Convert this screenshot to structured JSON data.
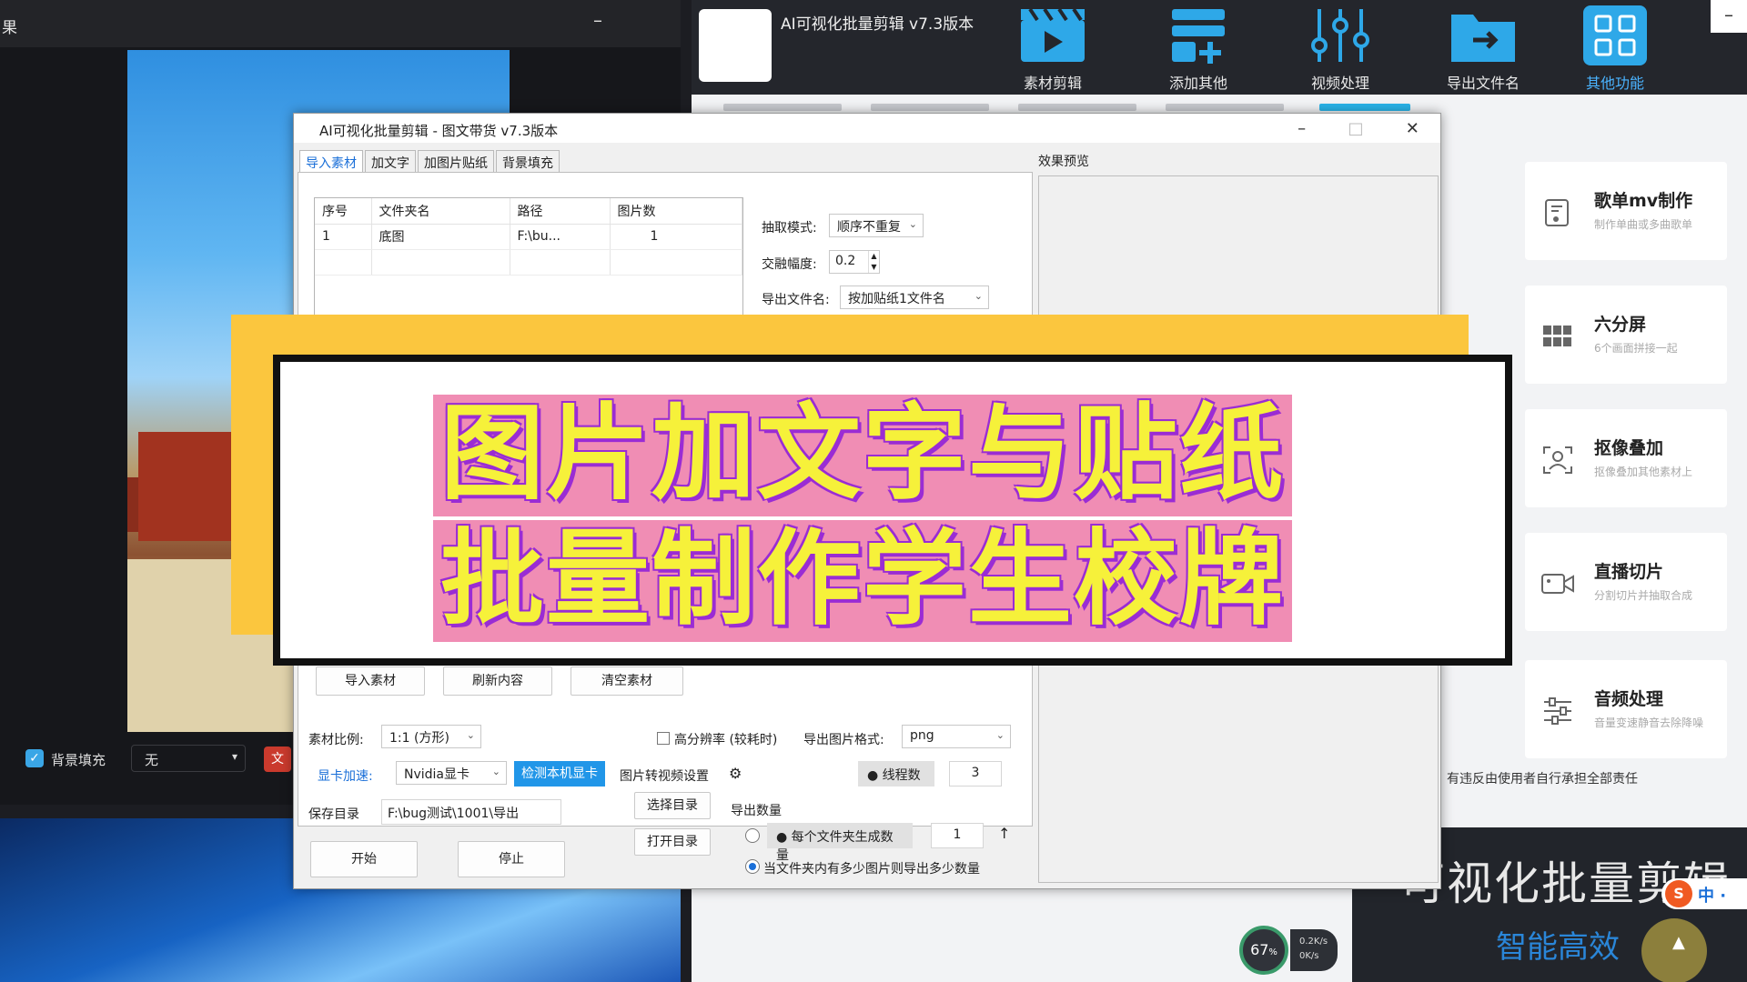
{
  "left_window": {
    "title": "果",
    "minimize": "–",
    "bg_fill_checkbox_label": "背景填充",
    "bg_fill_select": "无",
    "chip": "文"
  },
  "app": {
    "title": "AI可视化批量剪辑 v7.3版本",
    "close_btn": "–",
    "nav": [
      {
        "label": "素材剪辑",
        "icon": "clapperboard-icon"
      },
      {
        "label": "添加其他",
        "icon": "add-layers-icon"
      },
      {
        "label": "视频处理",
        "icon": "sliders-icon"
      },
      {
        "label": "导出文件名",
        "icon": "folder-export-icon"
      },
      {
        "label": "其他功能",
        "icon": "grid-apps-icon",
        "active": true
      }
    ],
    "cards": [
      {
        "title": "歌单mv制作",
        "sub": "制作单曲或多曲歌单",
        "icon": "music-list-icon"
      },
      {
        "title": "六分屏",
        "sub": "6个画面拼接一起",
        "icon": "six-grid-icon"
      },
      {
        "title": "抠像叠加",
        "sub": "抠像叠加其他素材上",
        "icon": "portrait-icon"
      },
      {
        "title": "直播切片",
        "sub": "分割切片并抽取合成",
        "icon": "video-camera-icon"
      },
      {
        "title": "音频处理",
        "sub": "音量变速静音去除降噪",
        "icon": "audio-sliders-icon"
      }
    ],
    "disclaimer": "有违反由使用者自行承担全部责任",
    "promo_title": "可视化批量剪辑",
    "promo_sub": "智能高效",
    "ime": {
      "s": "S",
      "mode": "中 ·"
    },
    "netmon": {
      "percent": "67",
      "unit": "%",
      "up": "0.2K/s",
      "down": "0K/s"
    }
  },
  "dialog": {
    "title": "AI可视化批量剪辑 - 图文带货 v7.3版本",
    "controls": {
      "min": "–",
      "max": "□",
      "close": "✕"
    },
    "tabs": [
      "导入素材",
      "加文字",
      "加图片贴纸",
      "背景填充"
    ],
    "table": {
      "headers": [
        "序号",
        "文件夹名",
        "路径",
        "图片数"
      ],
      "rows": [
        [
          "1",
          "底图",
          "F:\\bu...",
          "1"
        ]
      ]
    },
    "extract_mode_label": "抽取模式:",
    "extract_mode_value": "顺序不重复",
    "blend_label": "交融幅度:",
    "blend_value": "0.2",
    "export_name_label": "导出文件名:",
    "export_name_value": "按加贴纸1文件名",
    "preview_label": "效果预览",
    "buttons": {
      "import": "导入素材",
      "refresh": "刷新内容",
      "clear": "清空素材",
      "choose_dir": "选择目录",
      "open_dir": "打开目录",
      "start": "开始",
      "stop": "停止",
      "detect_gpu": "检测本机显卡"
    },
    "ratio_label": "素材比例:",
    "ratio_value": "1:1 (方形)",
    "hires_label": "高分辨率 (较耗时)",
    "format_label": "导出图片格式:",
    "format_value": "png",
    "gpu_label": "显卡加速:",
    "gpu_value": "Nvidia显卡",
    "video_settings_label": "图片转视频设置",
    "threads_label": "线程数",
    "threads_value": "3",
    "save_dir_label": "保存目录",
    "save_dir_value": "F:\\bug测试\\1001\\导出",
    "export_count_label": "导出数量",
    "per_folder_label": "每个文件夹生成数量",
    "per_folder_value": "1",
    "all_images_label": "当文件夹内有多少图片则导出多少数量"
  },
  "banner": {
    "line1": "图片加文字与贴纸",
    "line2": "批量制作学生校牌"
  },
  "colors": {
    "accent": "#1a6fd8",
    "banner_text": "#f6f13a",
    "banner_bg": "#f08db4",
    "frame_yellow": "#fbc63e"
  }
}
